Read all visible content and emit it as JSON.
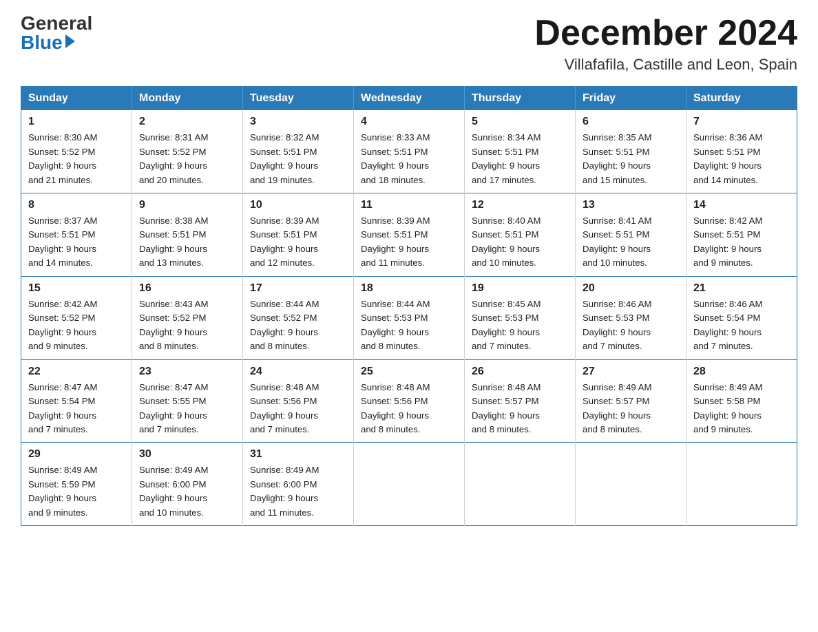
{
  "logo": {
    "general": "General",
    "blue": "Blue"
  },
  "header": {
    "month": "December 2024",
    "location": "Villafafila, Castille and Leon, Spain"
  },
  "days_of_week": [
    "Sunday",
    "Monday",
    "Tuesday",
    "Wednesday",
    "Thursday",
    "Friday",
    "Saturday"
  ],
  "weeks": [
    [
      {
        "day": "1",
        "sunrise": "8:30 AM",
        "sunset": "5:52 PM",
        "daylight": "9 hours and 21 minutes."
      },
      {
        "day": "2",
        "sunrise": "8:31 AM",
        "sunset": "5:52 PM",
        "daylight": "9 hours and 20 minutes."
      },
      {
        "day": "3",
        "sunrise": "8:32 AM",
        "sunset": "5:51 PM",
        "daylight": "9 hours and 19 minutes."
      },
      {
        "day": "4",
        "sunrise": "8:33 AM",
        "sunset": "5:51 PM",
        "daylight": "9 hours and 18 minutes."
      },
      {
        "day": "5",
        "sunrise": "8:34 AM",
        "sunset": "5:51 PM",
        "daylight": "9 hours and 17 minutes."
      },
      {
        "day": "6",
        "sunrise": "8:35 AM",
        "sunset": "5:51 PM",
        "daylight": "9 hours and 15 minutes."
      },
      {
        "day": "7",
        "sunrise": "8:36 AM",
        "sunset": "5:51 PM",
        "daylight": "9 hours and 14 minutes."
      }
    ],
    [
      {
        "day": "8",
        "sunrise": "8:37 AM",
        "sunset": "5:51 PM",
        "daylight": "9 hours and 14 minutes."
      },
      {
        "day": "9",
        "sunrise": "8:38 AM",
        "sunset": "5:51 PM",
        "daylight": "9 hours and 13 minutes."
      },
      {
        "day": "10",
        "sunrise": "8:39 AM",
        "sunset": "5:51 PM",
        "daylight": "9 hours and 12 minutes."
      },
      {
        "day": "11",
        "sunrise": "8:39 AM",
        "sunset": "5:51 PM",
        "daylight": "9 hours and 11 minutes."
      },
      {
        "day": "12",
        "sunrise": "8:40 AM",
        "sunset": "5:51 PM",
        "daylight": "9 hours and 10 minutes."
      },
      {
        "day": "13",
        "sunrise": "8:41 AM",
        "sunset": "5:51 PM",
        "daylight": "9 hours and 10 minutes."
      },
      {
        "day": "14",
        "sunrise": "8:42 AM",
        "sunset": "5:51 PM",
        "daylight": "9 hours and 9 minutes."
      }
    ],
    [
      {
        "day": "15",
        "sunrise": "8:42 AM",
        "sunset": "5:52 PM",
        "daylight": "9 hours and 9 minutes."
      },
      {
        "day": "16",
        "sunrise": "8:43 AM",
        "sunset": "5:52 PM",
        "daylight": "9 hours and 8 minutes."
      },
      {
        "day": "17",
        "sunrise": "8:44 AM",
        "sunset": "5:52 PM",
        "daylight": "9 hours and 8 minutes."
      },
      {
        "day": "18",
        "sunrise": "8:44 AM",
        "sunset": "5:53 PM",
        "daylight": "9 hours and 8 minutes."
      },
      {
        "day": "19",
        "sunrise": "8:45 AM",
        "sunset": "5:53 PM",
        "daylight": "9 hours and 7 minutes."
      },
      {
        "day": "20",
        "sunrise": "8:46 AM",
        "sunset": "5:53 PM",
        "daylight": "9 hours and 7 minutes."
      },
      {
        "day": "21",
        "sunrise": "8:46 AM",
        "sunset": "5:54 PM",
        "daylight": "9 hours and 7 minutes."
      }
    ],
    [
      {
        "day": "22",
        "sunrise": "8:47 AM",
        "sunset": "5:54 PM",
        "daylight": "9 hours and 7 minutes."
      },
      {
        "day": "23",
        "sunrise": "8:47 AM",
        "sunset": "5:55 PM",
        "daylight": "9 hours and 7 minutes."
      },
      {
        "day": "24",
        "sunrise": "8:48 AM",
        "sunset": "5:56 PM",
        "daylight": "9 hours and 7 minutes."
      },
      {
        "day": "25",
        "sunrise": "8:48 AM",
        "sunset": "5:56 PM",
        "daylight": "9 hours and 8 minutes."
      },
      {
        "day": "26",
        "sunrise": "8:48 AM",
        "sunset": "5:57 PM",
        "daylight": "9 hours and 8 minutes."
      },
      {
        "day": "27",
        "sunrise": "8:49 AM",
        "sunset": "5:57 PM",
        "daylight": "9 hours and 8 minutes."
      },
      {
        "day": "28",
        "sunrise": "8:49 AM",
        "sunset": "5:58 PM",
        "daylight": "9 hours and 9 minutes."
      }
    ],
    [
      {
        "day": "29",
        "sunrise": "8:49 AM",
        "sunset": "5:59 PM",
        "daylight": "9 hours and 9 minutes."
      },
      {
        "day": "30",
        "sunrise": "8:49 AM",
        "sunset": "6:00 PM",
        "daylight": "9 hours and 10 minutes."
      },
      {
        "day": "31",
        "sunrise": "8:49 AM",
        "sunset": "6:00 PM",
        "daylight": "9 hours and 11 minutes."
      },
      null,
      null,
      null,
      null
    ]
  ],
  "labels": {
    "sunrise": "Sunrise:",
    "sunset": "Sunset:",
    "daylight": "Daylight:"
  }
}
